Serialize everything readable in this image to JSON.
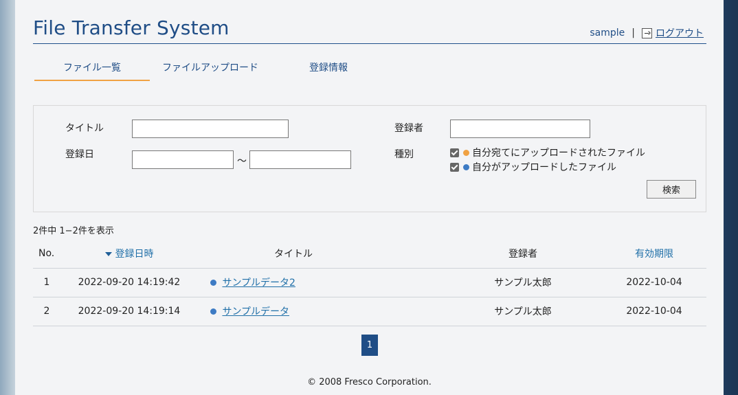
{
  "header": {
    "title": "File Transfer System",
    "username": "sample",
    "separator": "|",
    "logout_label": "ログアウト"
  },
  "tabs": [
    {
      "label": "ファイル一覧",
      "active": true
    },
    {
      "label": "ファイルアップロード",
      "active": false
    },
    {
      "label": "登録情報",
      "active": false
    }
  ],
  "search": {
    "title_label": "タイトル",
    "title_value": "",
    "registrant_label": "登録者",
    "registrant_value": "",
    "date_label": "登録日",
    "date_from": "",
    "date_to": "",
    "range_sep": "～",
    "type_label": "種別",
    "type_options": [
      {
        "label": "自分宛てにアップロードされたファイル",
        "checked": true,
        "dot_color": "#f0a243"
      },
      {
        "label": "自分がアップロードしたファイル",
        "checked": true,
        "dot_color": "#3d7bc4"
      }
    ],
    "search_button": "検索"
  },
  "results": {
    "count_text": "2件中 1−2件を表示",
    "columns": {
      "no": "No.",
      "date": "登録日時",
      "title": "タイトル",
      "registrant": "登録者",
      "expiry": "有効期限"
    },
    "rows": [
      {
        "no": "1",
        "date": "2022-09-20 14:19:42",
        "title": "サンプルデータ2",
        "registrant": "サンプル太郎",
        "expiry": "2022-10-04"
      },
      {
        "no": "2",
        "date": "2022-09-20 14:19:14",
        "title": "サンプルデータ",
        "registrant": "サンプル太郎",
        "expiry": "2022-10-04"
      }
    ]
  },
  "pagination": {
    "current": "1"
  },
  "footer": {
    "copyright": "© 2008 Fresco Corporation."
  }
}
